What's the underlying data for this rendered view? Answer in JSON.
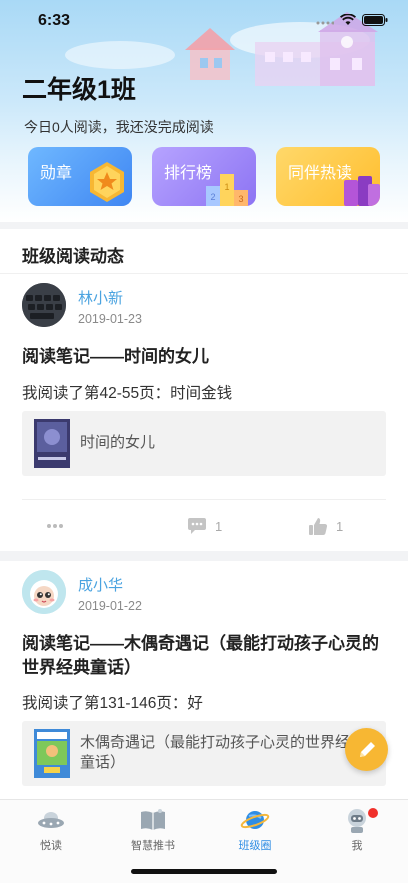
{
  "status_bar": {
    "time": "6:33"
  },
  "header": {
    "class_name": "二年级1班",
    "reading_status": "今日0人阅读，我还没完成阅读"
  },
  "features": [
    {
      "label": "勋章",
      "color": "#4a92f5"
    },
    {
      "label": "排行榜",
      "color": "#9a83f6"
    },
    {
      "label": "同伴热读",
      "color": "#ffc53f"
    }
  ],
  "feed": {
    "section_title": "班级阅读动态",
    "posts": [
      {
        "user": "林小新",
        "date": "2019-01-23",
        "title": "阅读笔记——时间的女儿",
        "progress": "我阅读了第42-55页：时间金钱",
        "book": "时间的女儿",
        "comments": "1",
        "likes": "1"
      },
      {
        "user": "成小华",
        "date": "2019-01-22",
        "title": "阅读笔记——木偶奇遇记（最能打动孩子心灵的世界经典童话）",
        "progress": "我阅读了第131-146页：好",
        "book": "木偶奇遇记（最能打动孩子心灵的世界经典童话）"
      }
    ]
  },
  "tabs": [
    {
      "label": "悦读",
      "icon": "ufo-icon"
    },
    {
      "label": "智慧推书",
      "icon": "book-icon"
    },
    {
      "label": "班级圈",
      "icon": "planet-icon",
      "active": true
    },
    {
      "label": "我",
      "icon": "robot-icon",
      "has_badge": true
    }
  ],
  "colors": {
    "accent": "#2f8de4",
    "username": "#4aa3e0",
    "fab": "#f7b733"
  }
}
